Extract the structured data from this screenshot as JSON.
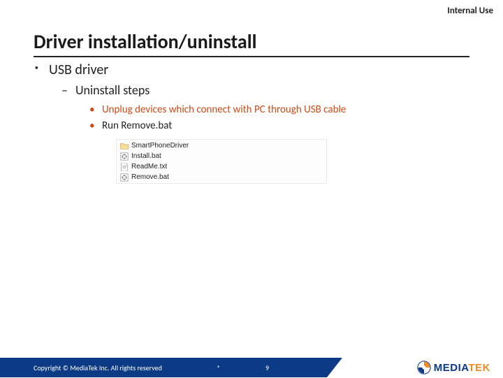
{
  "classification": "Internal Use",
  "title": "Driver installation/uninstall",
  "bullets": {
    "l1": "USB driver",
    "l2": "Uninstall steps",
    "l3a": "Unplug devices which connect with PC through USB cable",
    "l3b": "Run Remove.bat"
  },
  "files": {
    "folder": "SmartPhoneDriver",
    "install": "Install.bat",
    "readme": "ReadMe.txt",
    "remove": "Remove.bat"
  },
  "footer": {
    "copyright": "Copyright © MediaTek Inc. All rights reserved",
    "star": "*",
    "page": "9",
    "brand_a": "MEDIA",
    "brand_b": "TEK"
  }
}
